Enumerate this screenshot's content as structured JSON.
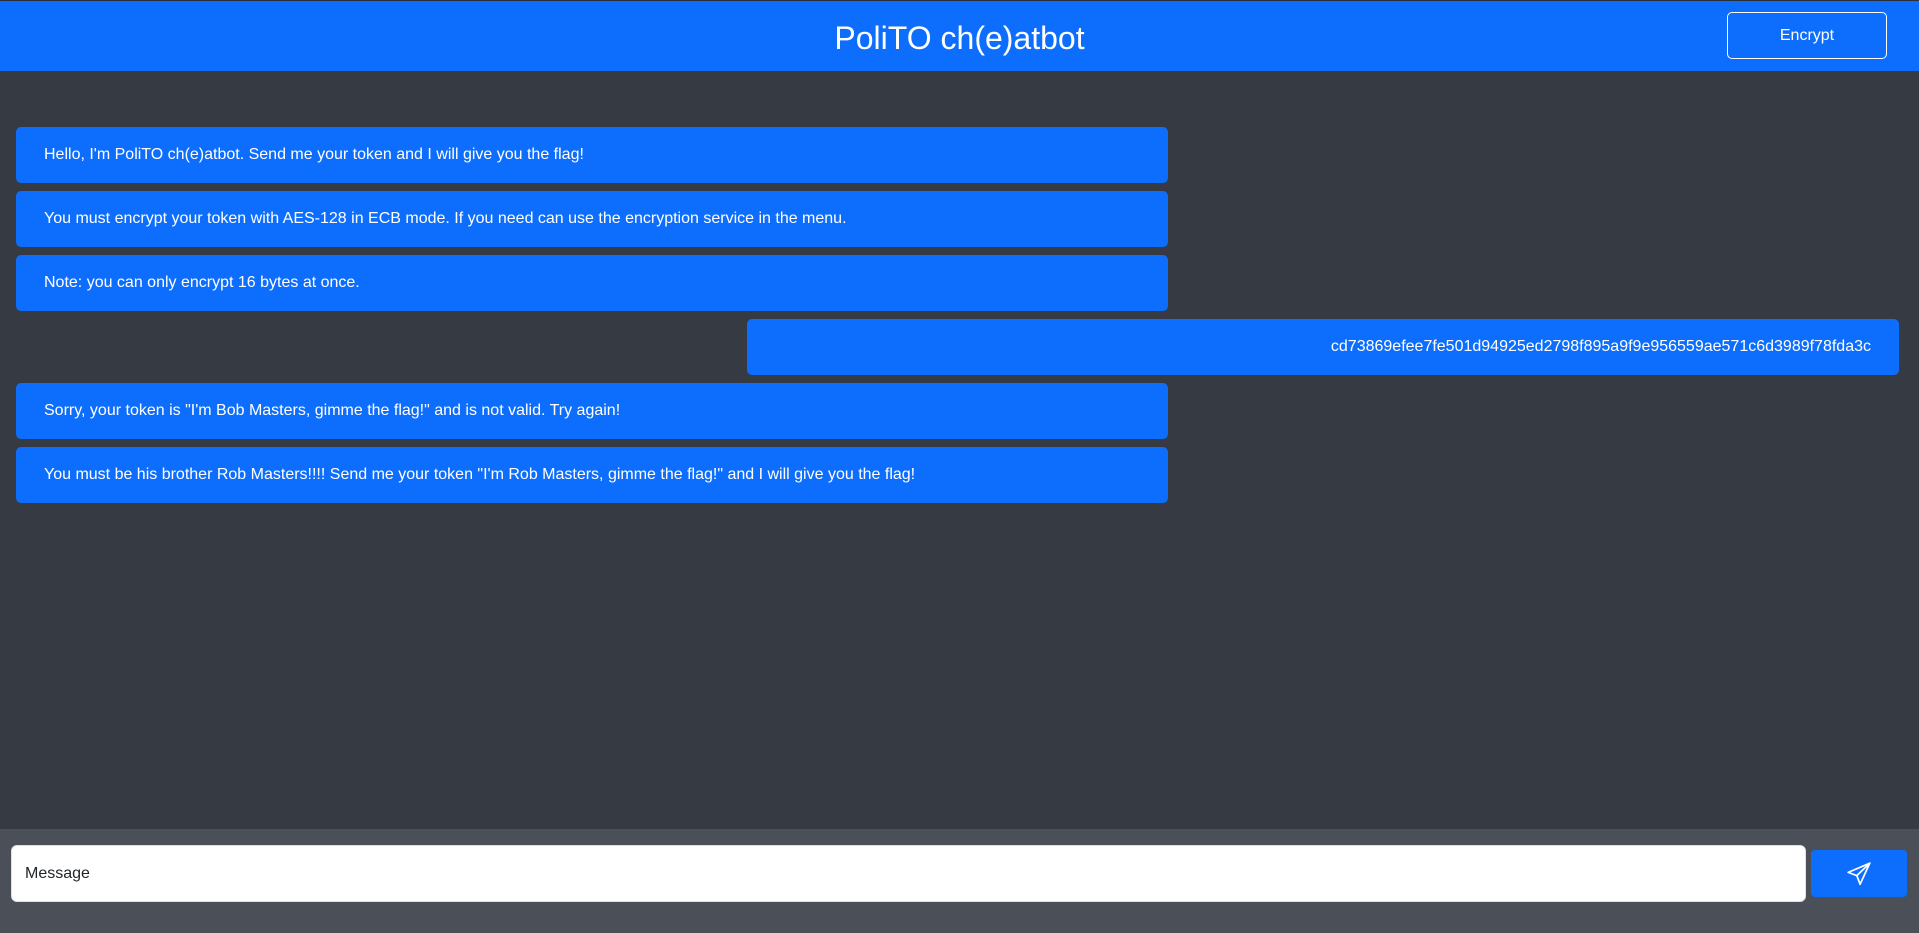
{
  "header": {
    "title": "PoliTO ch(e)atbot",
    "encrypt_label": "Encrypt"
  },
  "chat": {
    "messages": [
      {
        "sender": "bot",
        "text": "Hello, I'm PoliTO ch(e)atbot. Send me your token and I will give you the flag!"
      },
      {
        "sender": "bot",
        "text": "You must encrypt your token with AES-128 in ECB mode. If you need can use the encryption service in the menu."
      },
      {
        "sender": "bot",
        "text": "Note: you can only encrypt 16 bytes at once."
      },
      {
        "sender": "user",
        "text": "cd73869efee7fe501d94925ed2798f895a9f9e956559ae571c6d3989f78fda3c"
      },
      {
        "sender": "bot",
        "text": "Sorry, your token is \"I'm Bob Masters, gimme the flag!\" and is not valid. Try again!"
      },
      {
        "sender": "bot",
        "text": "You must be his brother Rob Masters!!!! Send me your token \"I'm Rob Masters, gimme the flag!\" and I will give you the flag!"
      }
    ]
  },
  "composer": {
    "placeholder": "Message",
    "value": "",
    "send_icon": "paper-plane-icon"
  },
  "colors": {
    "accent": "#0d6efd",
    "chat_background": "#353a43",
    "footer_background": "#4a4f58"
  }
}
